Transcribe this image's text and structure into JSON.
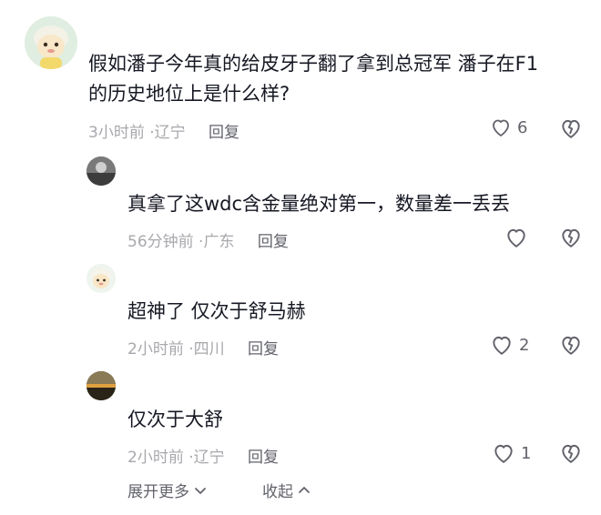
{
  "comments": [
    {
      "text_line1": "假如潘子今年真的给皮牙子翻了拿到总冠军 潘子在F1",
      "text_line2": "的历史地位上是什么样?",
      "time": "3小时前",
      "location": "辽宁",
      "reply_label": "回复",
      "likes": "6"
    },
    {
      "text": "真拿了这wdc含金量绝对第一，数量差一丢丢",
      "time": "56分钟前",
      "location": "广东",
      "reply_label": "回复",
      "likes": ""
    },
    {
      "text": "超神了 仅次于舒马赫",
      "time": "2小时前",
      "location": "四川",
      "reply_label": "回复",
      "likes": "2"
    },
    {
      "text": "仅次于大舒",
      "time": "2小时前",
      "location": "辽宁",
      "reply_label": "回复",
      "likes": "1"
    }
  ],
  "footer": {
    "expand_label": "展开更多",
    "collapse_label": "收起"
  },
  "colors": {
    "text": "#161823",
    "meta": "#a8a8ad",
    "action": "#62636b"
  },
  "icons": [
    "heart-icon",
    "broken-heart-icon",
    "chevron-down-icon",
    "chevron-up-icon"
  ]
}
